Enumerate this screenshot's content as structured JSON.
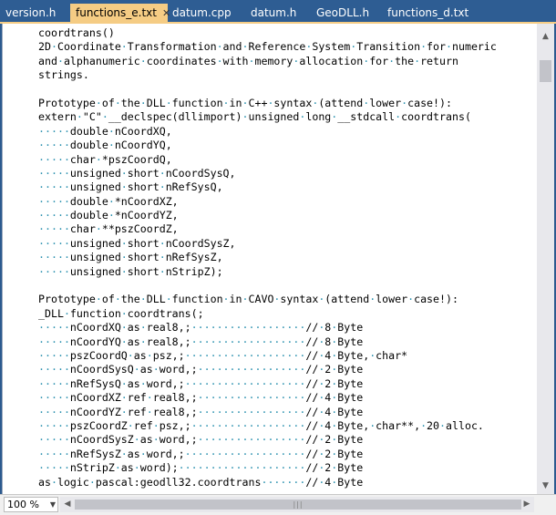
{
  "tabs": [
    {
      "label": "version.h",
      "active": false
    },
    {
      "label": "functions_e.txt",
      "active": true
    },
    {
      "label": "datum.cpp",
      "active": false
    },
    {
      "label": "datum.h",
      "active": false
    },
    {
      "label": "GeoDLL.h",
      "active": false
    },
    {
      "label": "functions_d.txt",
      "active": false
    }
  ],
  "tab_close_glyph": "✕",
  "editor": {
    "lines": [
      "coordtrans()",
      "2D Coordinate Transformation and Reference System Transition for numeric",
      "and alphanumeric coordinates with memory allocation for the return",
      "strings.",
      "",
      "Prototype of the DLL function in C++ syntax (attend lower case!):",
      "extern \"C\" __declspec(dllimport) unsigned long __stdcall coordtrans(",
      "     double nCoordXQ,",
      "     double nCoordYQ,",
      "     char *pszCoordQ,",
      "     unsigned short nCoordSysQ,",
      "     unsigned short nRefSysQ,",
      "     double *nCoordXZ,",
      "     double *nCoordYZ,",
      "     char **pszCoordZ,",
      "     unsigned short nCoordSysZ,",
      "     unsigned short nRefSysZ,",
      "     unsigned short nStripZ);",
      "",
      "Prototype of the DLL function in CAVO syntax (attend lower case!):",
      "_DLL function coordtrans(;",
      "     nCoordXQ as real8,;                  // 8 Byte",
      "     nCoordYQ as real8,;                  // 8 Byte",
      "     pszCoordQ as psz,;                   // 4 Byte, char*",
      "     nCoordSysQ as word,;                 // 2 Byte",
      "     nRefSysQ as word,;                   // 2 Byte",
      "     nCoordXZ ref real8,;                 // 4 Byte",
      "     nCoordYZ ref real8,;                 // 4 Byte",
      "     pszCoordZ ref psz,;                  // 4 Byte, char**, 20 alloc.",
      "     nCoordSysZ as word,;                 // 2 Byte",
      "     nRefSysZ as word,;                   // 2 Byte",
      "     nStripZ as word);                    // 2 Byte",
      "as logic pascal:geodll32.coordtrans       // 4 Byte"
    ]
  },
  "statusbar": {
    "zoom": "100 %"
  },
  "colors": {
    "tab_active_bg": "#f5cc84",
    "tabbar_bg": "#2e5d93",
    "whitespace_dot": "#2b91af"
  }
}
